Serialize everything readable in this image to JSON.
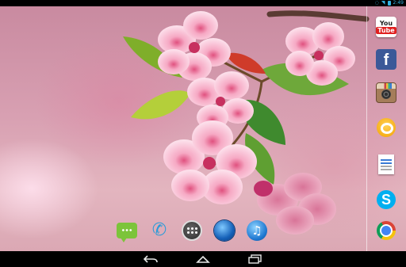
{
  "status_bar": {
    "time": "2:49",
    "icons": [
      "notification-icon",
      "wifi-icon",
      "battery-icon"
    ]
  },
  "wallpaper": {
    "subject": "cherry-blossom-wallpaper"
  },
  "hotseat": {
    "apps": [
      {
        "name": "messaging-icon"
      },
      {
        "name": "phone-icon"
      },
      {
        "name": "app-drawer-icon"
      },
      {
        "name": "browser-icon"
      },
      {
        "name": "music-icon"
      }
    ]
  },
  "sidebar": {
    "apps": [
      {
        "name": "youtube-icon",
        "line1": "You",
        "line2": "Tube"
      },
      {
        "name": "facebook-icon",
        "glyph": "f"
      },
      {
        "name": "instagram-icon"
      },
      {
        "name": "go-launcher-icon"
      },
      {
        "name": "document-icon"
      },
      {
        "name": "skype-icon",
        "glyph": "S"
      },
      {
        "name": "chrome-icon"
      }
    ]
  },
  "nav_bar": {
    "buttons": [
      "back-icon",
      "home-icon",
      "recents-icon"
    ]
  },
  "colors": {
    "status_accent": "#33b5e5",
    "facebook": "#3b5998",
    "skype": "#00aff0",
    "youtube_red": "#e02020"
  }
}
